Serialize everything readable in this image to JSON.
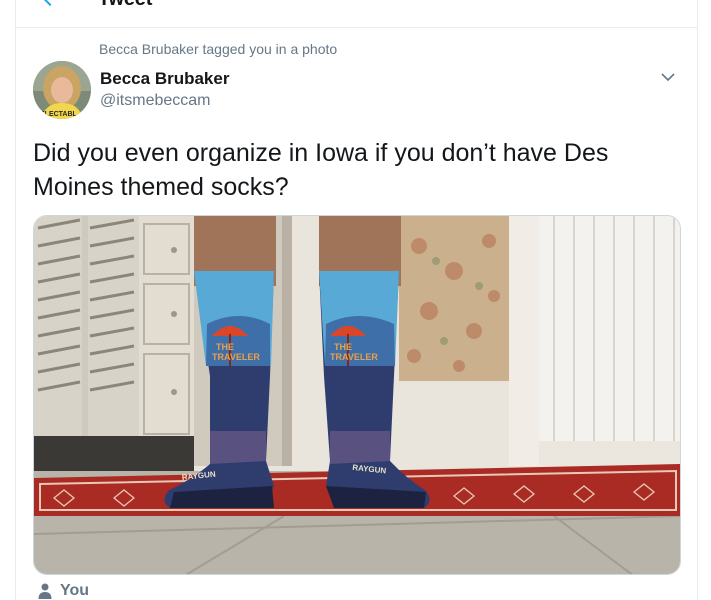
{
  "header": {
    "title": "Tweet",
    "back_icon": "arrow-left-icon",
    "accent_color": "#1da1f2"
  },
  "tweet": {
    "social_context": "Becca Brubaker tagged you in a photo",
    "author_name": "Becca Brubaker",
    "author_handle": "@itsmebeccam",
    "text": "Did you even organize in Iowa if you don’t have Des Moines themed socks?",
    "menu_icon": "chevron-down-icon",
    "photo": {
      "sock_print": [
        "THE",
        "TRAVELER"
      ],
      "sock_brand": "RAYGUN"
    },
    "tagged_user": "You",
    "tagged_icon": "person-icon"
  }
}
